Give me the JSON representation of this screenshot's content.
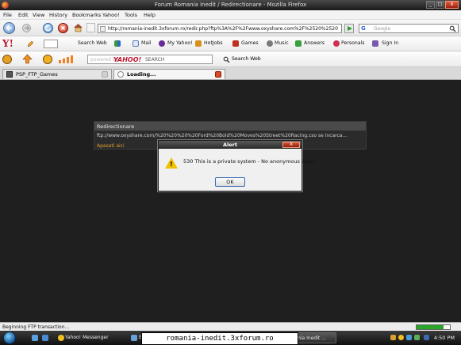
{
  "window": {
    "title": "Forum Romania Inedit / Redirectionare - Mozilla Firefox",
    "controls": [
      "_",
      "□",
      "X"
    ]
  },
  "menu": [
    "File",
    "Edit",
    "View",
    "History",
    "Bookmarks",
    "Yahoo!",
    "Tools",
    "Help"
  ],
  "nav": {
    "url": "http://romania-inedit.3xforum.ro/redir.php?ftp%3A%2F%2Fwww.oxyshare.com%2F%2520%2520%2520",
    "search_placeholder": "Google"
  },
  "yahoo_toolbar": {
    "search_web": "Search Web",
    "items": [
      "Mail",
      "My Yahoo!",
      "HotJobs",
      "Games",
      "Music",
      "Answers",
      "Personals",
      "Sign In"
    ]
  },
  "toolbar2": {
    "search_placeholder": "powered by",
    "brand": "YAHOO!",
    "search_label": "SEARCH",
    "search_web": "Search Web"
  },
  "tabs": [
    {
      "label": "PSP_FTP_Games"
    },
    {
      "label": "Loading..."
    }
  ],
  "redirect": {
    "header": "Redirectionare",
    "message": "ftp://www.oxyshare.com/%20%20%20%20Ford%20Bold%20Moves%20Street%20Racing.cso se incarca...",
    "link": "Apasati aici"
  },
  "alert": {
    "title": "Alert",
    "message": "530 This is a private system - No anonymous login",
    "ok_label": "OK",
    "close_label": "X"
  },
  "status": {
    "text": "Beginning FTP transaction...",
    "progress": 0.8
  },
  "taskbar": {
    "items": [
      "Yahoo! Messenger",
      "E",
      "Romania Inedit ..."
    ],
    "tooltip": "romania-inedit.3xforum.ro",
    "clock": "4:50 PM"
  }
}
